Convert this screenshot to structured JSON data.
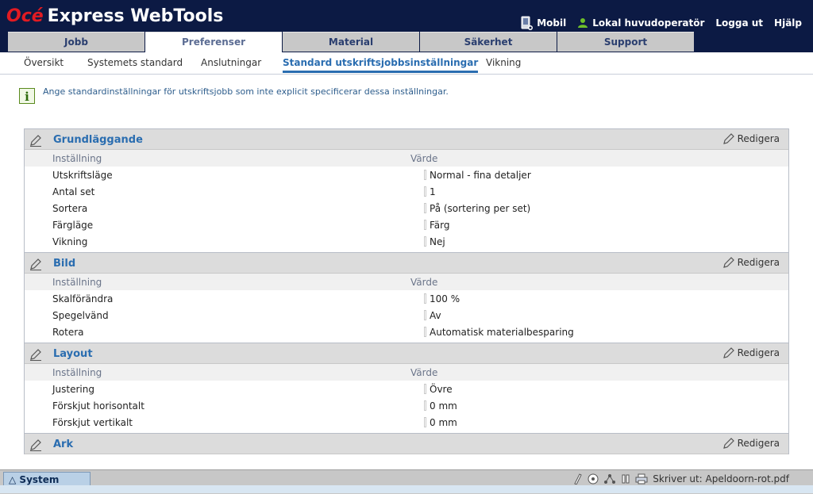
{
  "app": {
    "brand": "Océ",
    "title": "Express WebTools"
  },
  "toplinks": {
    "mobile": "Mobil",
    "user": "Lokal huvudoperatör",
    "logout": "Logga ut",
    "help": "Hjälp"
  },
  "tabs": [
    {
      "label": "Jobb",
      "active": false
    },
    {
      "label": "Preferenser",
      "active": true
    },
    {
      "label": "Material",
      "active": false
    },
    {
      "label": "Säkerhet",
      "active": false
    },
    {
      "label": "Support",
      "active": false
    }
  ],
  "subnav": [
    {
      "label": "Översikt",
      "active": false
    },
    {
      "label": "Systemets standard",
      "active": false
    },
    {
      "label": "Anslutningar",
      "active": false
    },
    {
      "label": "Standard utskriftsjobbsinställningar",
      "active": true
    },
    {
      "label": "Vikning",
      "active": false
    }
  ],
  "info": {
    "text": "Ange standardinställningar för utskriftsjobb som inte explicit specificerar dessa inställningar."
  },
  "columns": {
    "setting": "Inställning",
    "value": "Värde"
  },
  "edit_label": "Redigera",
  "sections": [
    {
      "title": "Grundläggande",
      "rows": [
        {
          "key": "Utskriftsläge",
          "value": "Normal - fina detaljer"
        },
        {
          "key": "Antal set",
          "value": "1"
        },
        {
          "key": "Sortera",
          "value": "På (sortering per set)"
        },
        {
          "key": "Färgläge",
          "value": "Färg"
        },
        {
          "key": "Vikning",
          "value": "Nej"
        }
      ]
    },
    {
      "title": "Bild",
      "rows": [
        {
          "key": "Skalförändra",
          "value": "100 %"
        },
        {
          "key": "Spegelvänd",
          "value": "Av"
        },
        {
          "key": "Rotera",
          "value": "Automatisk materialbesparing"
        }
      ]
    },
    {
      "title": "Layout",
      "rows": [
        {
          "key": "Justering",
          "value": "Övre"
        },
        {
          "key": "Förskjut horisontalt",
          "value": "0 mm"
        },
        {
          "key": "Förskjut vertikalt",
          "value": "0 mm"
        }
      ]
    },
    {
      "title": "Ark",
      "rows": []
    }
  ],
  "bottombar": {
    "system_label": "System",
    "status_text": "Skriver ut: Apeldoorn-rot.pdf"
  },
  "colors": {
    "header_bg": "#0c1a44",
    "accent": "#2a6db0",
    "brand_red": "#e21b22"
  }
}
